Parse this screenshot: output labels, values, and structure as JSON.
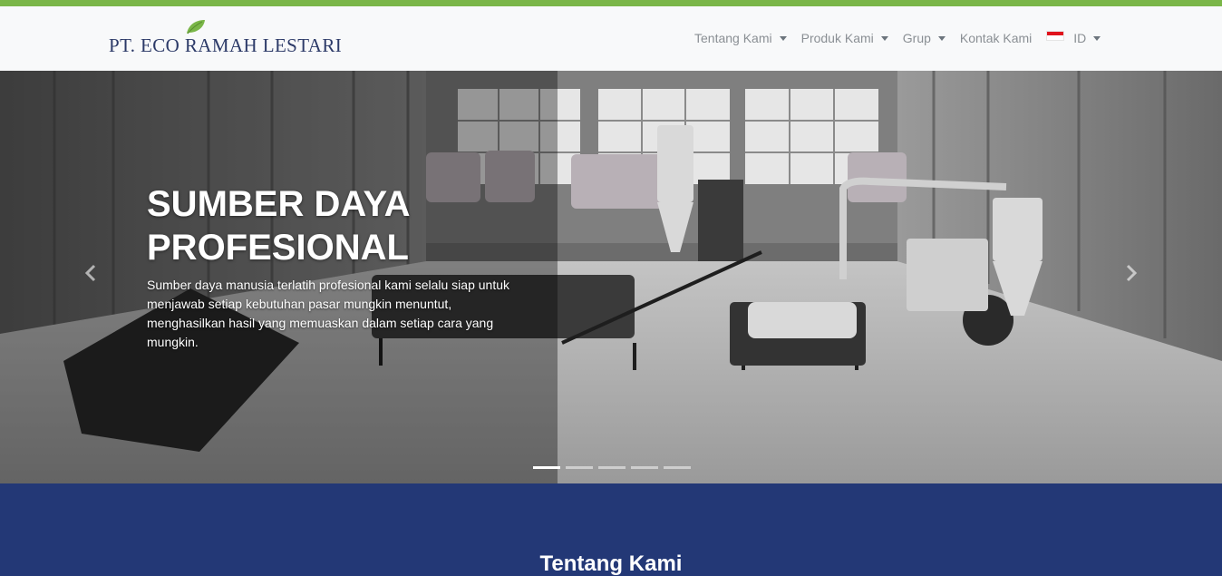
{
  "colors": {
    "top_accent": "#7ab648",
    "navbar_bg": "#f8f9fa",
    "brand_text": "#2c3a68",
    "nav_text": "#8a8f94",
    "section_bg": "#233876"
  },
  "brand": {
    "name": "PT. ECO RAMAH LESTARI",
    "icon": "leaf-icon"
  },
  "nav": {
    "items": [
      {
        "label": "Tentang Kami",
        "dropdown": true
      },
      {
        "label": "Produk Kami",
        "dropdown": true
      },
      {
        "label": "Grup",
        "dropdown": true
      },
      {
        "label": "Kontak Kami",
        "dropdown": false
      }
    ],
    "language": {
      "label": "ID",
      "flag": "indonesia-flag-icon",
      "dropdown": true
    }
  },
  "hero": {
    "title": "SUMBER DAYA PROFESIONAL",
    "body": "Sumber daya manusia terlatih profesional kami selalu siap untuk menjawab setiap kebutuhan pasar mungkin menuntut, menghasilkan hasil yang memuaskan dalam setiap cara yang mungkin.",
    "prev_icon": "chevron-left-icon",
    "next_icon": "chevron-right-icon",
    "slide_count": 5,
    "active_slide": 1
  },
  "about": {
    "title": "Tentang Kami"
  }
}
